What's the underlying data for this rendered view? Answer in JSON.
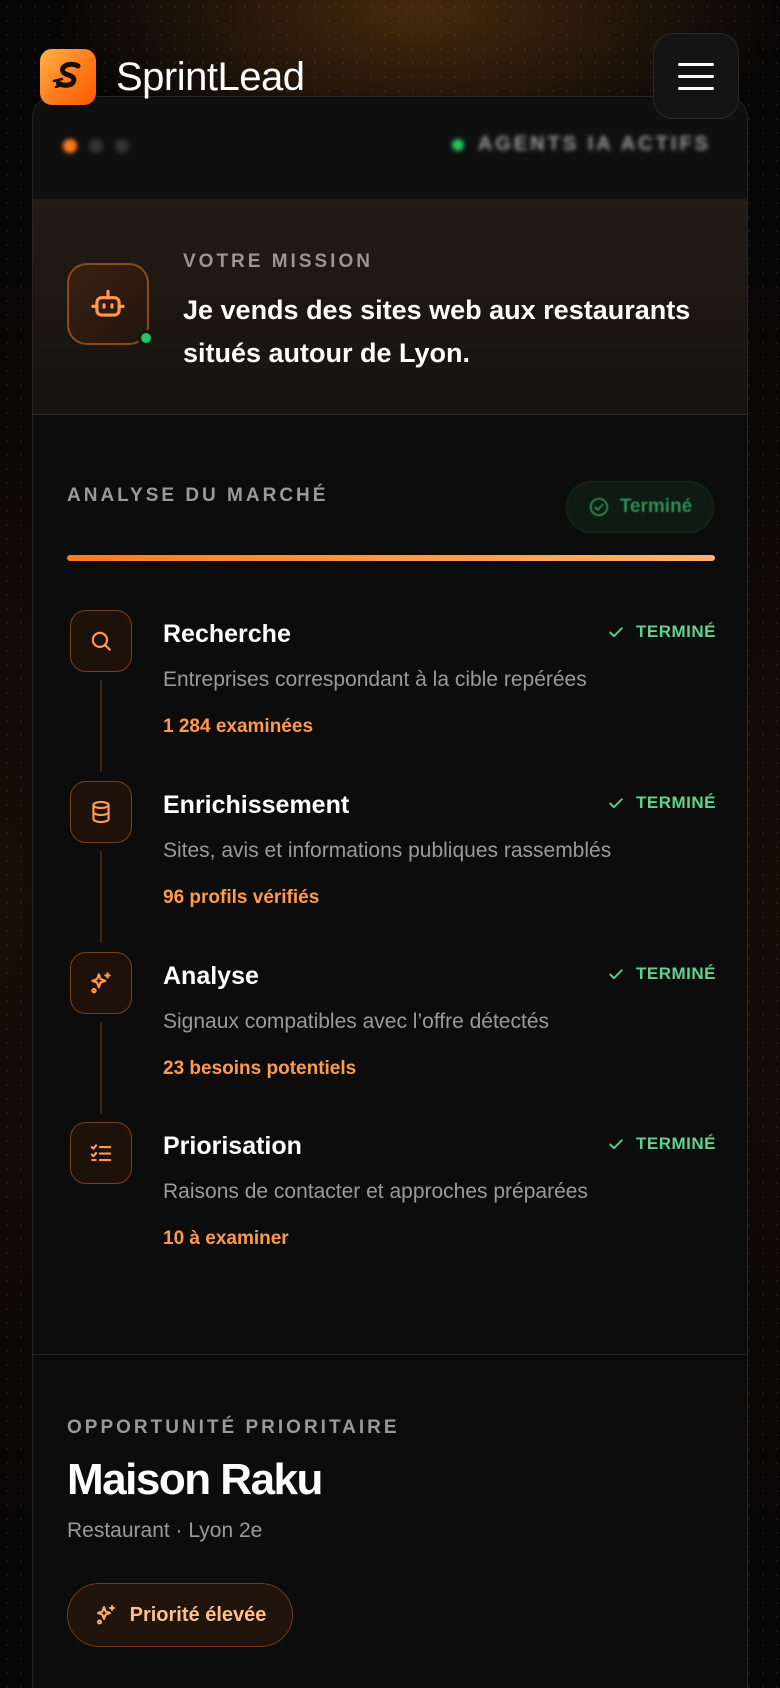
{
  "header": {
    "brand": "SprintLead",
    "logo_icon": "s-logo-icon",
    "menu_icon": "hamburger-menu-icon"
  },
  "topbar": {
    "agents_label": "AGENTS IA ACTIFS"
  },
  "mission": {
    "label": "VOTRE MISSION",
    "text": "Je vends des sites web aux restaurants situés autour de Lyon.",
    "icon": "robot-icon"
  },
  "analysis": {
    "title": "ANALYSE DU MARCHÉ",
    "status_pill": "Terminé",
    "progress": 1.0,
    "steps": [
      {
        "title": "Recherche",
        "status": "TERMINÉ",
        "desc": "Entreprises correspondant à la cible repérées",
        "metric": "1 284 examinées",
        "icon": "search-icon"
      },
      {
        "title": "Enrichissement",
        "status": "TERMINÉ",
        "desc": "Sites, avis et informations publiques rassemblés",
        "metric": "96 profils vérifiés",
        "icon": "database-icon"
      },
      {
        "title": "Analyse",
        "status": "TERMINÉ",
        "desc": "Signaux compatibles avec l’offre détectés",
        "metric": "23 besoins potentiels",
        "icon": "sparkles-icon"
      },
      {
        "title": "Priorisation",
        "status": "TERMINÉ",
        "desc": "Raisons de contacter et approches préparées",
        "metric": "10 à examiner",
        "icon": "checklist-icon"
      }
    ]
  },
  "opportunity": {
    "label": "OPPORTUNITÉ PRIORITAIRE",
    "name": "Maison Raku",
    "meta": "Restaurant · Lyon 2e",
    "priority": "Priorité élevée"
  },
  "colors": {
    "accent": "#ff7a1a",
    "success": "#5fd38e",
    "background": "#070606"
  }
}
